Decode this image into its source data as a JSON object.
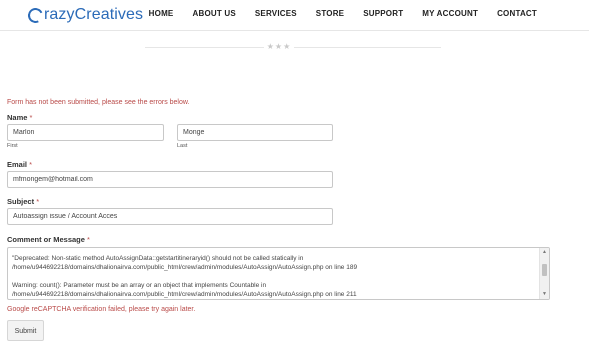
{
  "brand": {
    "logo_text": "razyCreatives"
  },
  "nav": [
    "HOME",
    "ABOUT US",
    "SERVICES",
    "STORE",
    "SUPPORT",
    "MY ACCOUNT",
    "CONTACT"
  ],
  "divider": {
    "stars": "★★★"
  },
  "form": {
    "error_message": "Form has not been submitted, please see the errors below.",
    "name": {
      "label": "Name",
      "required_mark": "*",
      "first_value": "Marlon",
      "last_value": "Monge",
      "first_sublabel": "First",
      "last_sublabel": "Last"
    },
    "email": {
      "label": "Email",
      "required_mark": "*",
      "value": "mfmongem@hotmail.com"
    },
    "subject": {
      "label": "Subject",
      "required_mark": "*",
      "value": "Autoassign issue / Account Acces"
    },
    "comment": {
      "label": "Comment or Message",
      "required_mark": "*",
      "lines": [
        "\"Deprecated: Non-static method AutoAssignData::getstartitineraryid() should not be called statically in /home/u944692218/domains/dhalionairva.com/public_html/crew/admin/modules/AutoAssign/AutoAssign.php on line 189",
        "Warning: count(): Parameter must be an array or an object that implements Countable in /home/u944692218/domains/dhalionairva.com/public_html/crew/admin/modules/AutoAssign/AutoAssign.php on line 211"
      ]
    },
    "captcha_error": "Google reCAPTCHA verification failed, please try again later.",
    "submit_label": "Submit"
  },
  "colors": {
    "brand": "#2b6bb8",
    "error": "#b94a48"
  }
}
